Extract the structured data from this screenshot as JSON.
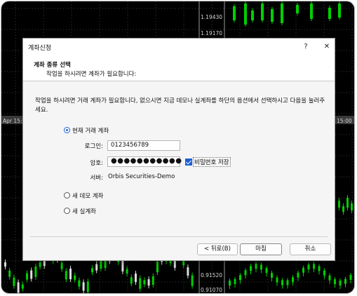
{
  "background_chart": {
    "price_labels": [
      "1.19430",
      "1.19170",
      "0.91520",
      "0.91070"
    ],
    "date_labels": [
      "Apr 15:00",
      "15:00"
    ]
  },
  "dialog": {
    "title": "계좌신청",
    "help_icon": "?",
    "close_icon": "✕",
    "header_title": "계좌 종류 선택",
    "header_subtitle": "작업을 하시려면 계좌가 필요합니다:",
    "description": "작업을 하시려면 거래 계좌가 필요합니다, 없으시면 지금 데모나 실계좌를 하단의 옵션에서 선택하시고 다음을 눌러주세요.",
    "options": [
      {
        "label": "현재 거래 계좌",
        "selected": true
      },
      {
        "label": "새 데모 계좌",
        "selected": false
      },
      {
        "label": "새 실계좌",
        "selected": false
      }
    ],
    "login_label": "로그인:",
    "login_value": "0123456789",
    "password_label": "암호:",
    "password_value": "●●●●●●●●●●●",
    "save_password_label": "비밀번호 저장",
    "save_password_checked": true,
    "server_label": "서버:",
    "server_value": "Orbis Securities-Demo",
    "buttons": {
      "back": "< 뒤로(B)",
      "finish": "마침",
      "cancel": "취소"
    }
  },
  "colors": {
    "candle_green": "#00d000",
    "chart_bg": "#000000",
    "accent": "#1c5fd6"
  }
}
